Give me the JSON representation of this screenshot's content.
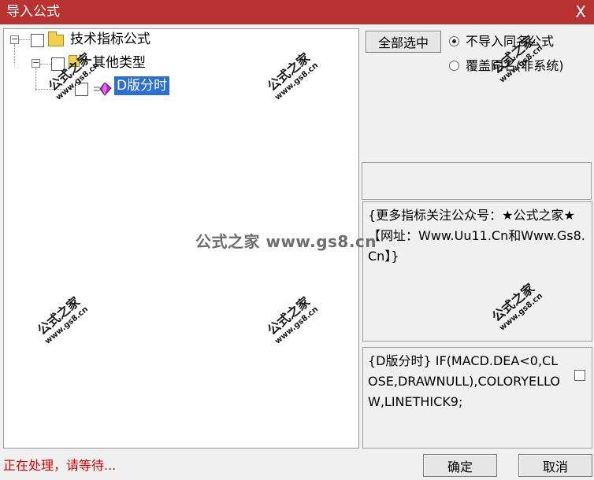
{
  "window": {
    "title": "导入公式",
    "close_glyph": "X"
  },
  "tree": {
    "root": {
      "label": "技术指标公式",
      "expander": "⊟",
      "checked": false,
      "icon": "folder-icon"
    },
    "group": {
      "label": "其他类型",
      "expander": "⊟",
      "checked": false,
      "icon": "folder-icon"
    },
    "item": {
      "label": "D版分时",
      "checked": false,
      "icon": "formula-gem-icon",
      "selected": true
    }
  },
  "actions": {
    "select_all_label": "全部选中",
    "radio_skip_label": "不导入同名公式",
    "radio_overwrite_label": "覆盖同名(非系统)",
    "radio_selected": "skip",
    "confirm_label": "确定",
    "cancel_label": "取消"
  },
  "description": {
    "text": "{更多指标关注公众号：★公式之家★【网址：Www.Uu11.Cn和Www.Gs8.Cn】}"
  },
  "formula": {
    "text": "{D版分时} IF(MACD.DEA<0,CLOSE,DRAWNULL),COLORYELLOW,LINETHICK9;"
  },
  "status": {
    "text": "正在处理，请等待..."
  },
  "watermark": {
    "brand": "公式之家",
    "site": "www.gs8.cn",
    "center_text": "公式之家 www.gs8.cn"
  },
  "colors": {
    "titlebar": "#b83232",
    "selection": "#2b6fd3",
    "status_text": "#e00000"
  }
}
